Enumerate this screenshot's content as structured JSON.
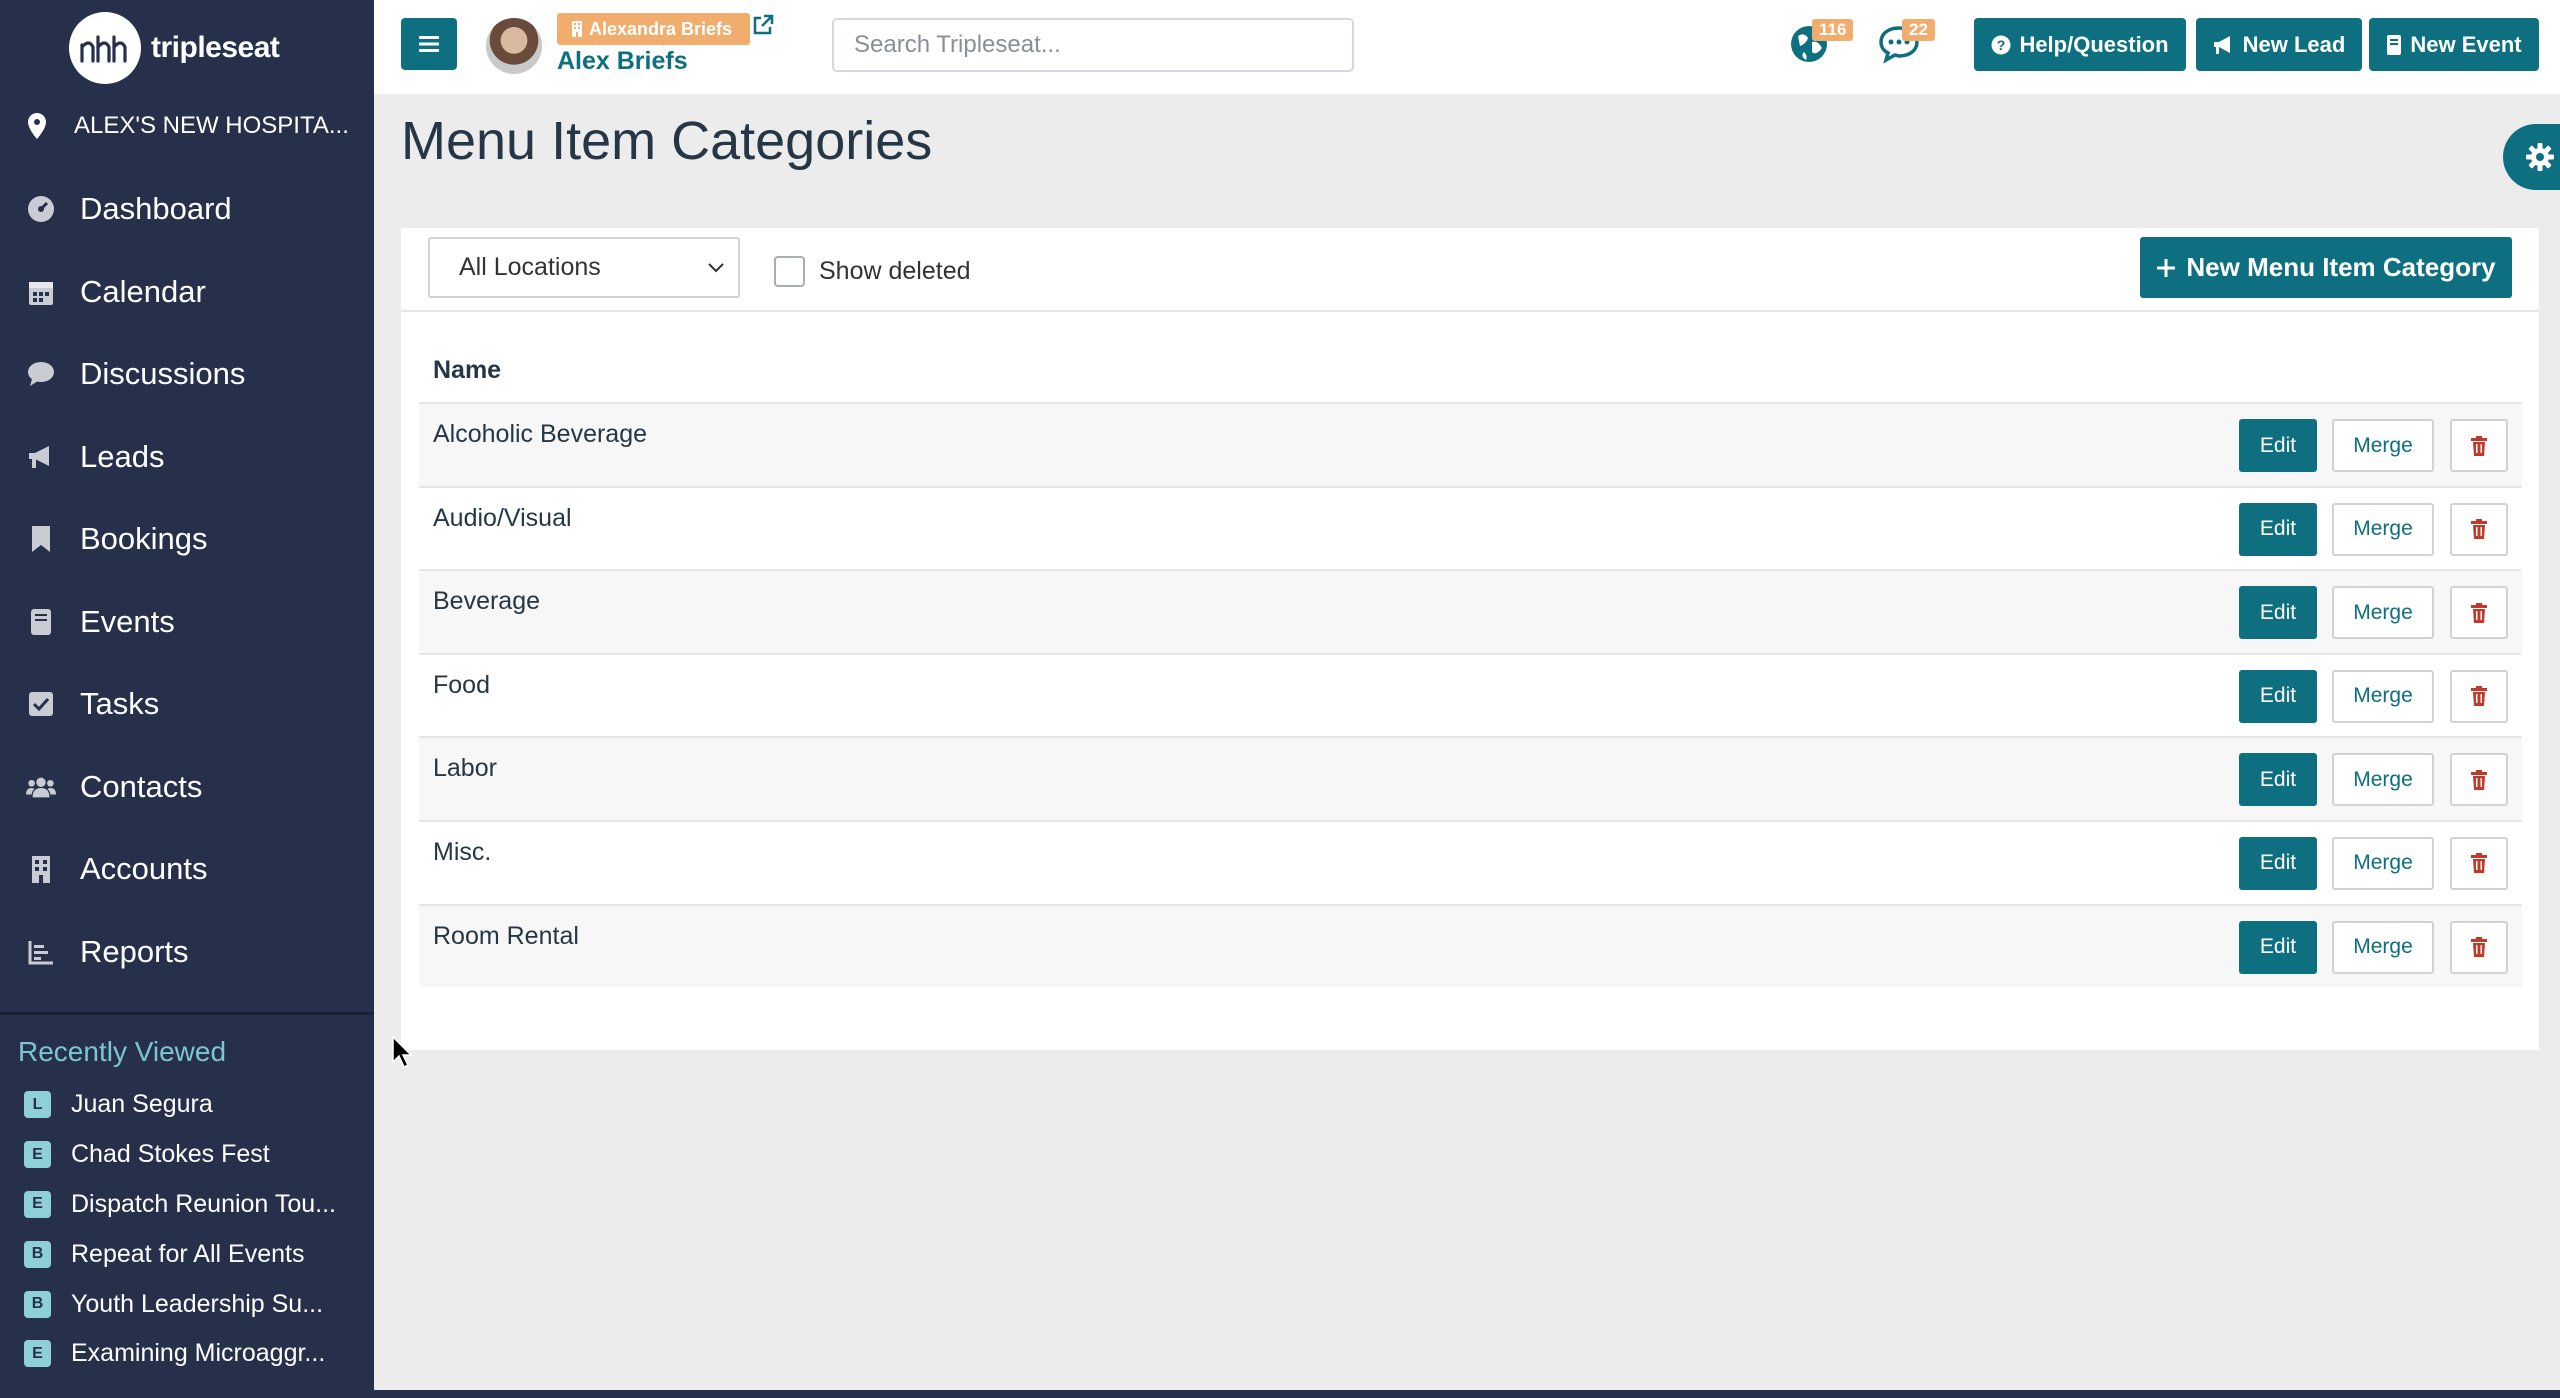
{
  "app": {
    "logo_text": "tripleseat",
    "location": "ALEX'S NEW HOSPITA...",
    "nav": [
      {
        "label": "Dashboard",
        "icon": "dashboard-icon"
      },
      {
        "label": "Calendar",
        "icon": "calendar-icon"
      },
      {
        "label": "Discussions",
        "icon": "chat-bubble-icon"
      },
      {
        "label": "Leads",
        "icon": "megaphone-icon"
      },
      {
        "label": "Bookings",
        "icon": "bookmark-icon"
      },
      {
        "label": "Events",
        "icon": "book-icon"
      },
      {
        "label": "Tasks",
        "icon": "checkbox-icon"
      },
      {
        "label": "Contacts",
        "icon": "users-icon"
      },
      {
        "label": "Accounts",
        "icon": "building-icon"
      },
      {
        "label": "Reports",
        "icon": "bar-chart-icon"
      }
    ],
    "recently_viewed": {
      "title": "Recently Viewed",
      "items": [
        {
          "badge": "L",
          "label": "Juan Segura"
        },
        {
          "badge": "E",
          "label": "Chad Stokes Fest"
        },
        {
          "badge": "E",
          "label": "Dispatch Reunion Tou..."
        },
        {
          "badge": "B",
          "label": "Repeat for All Events"
        },
        {
          "badge": "B",
          "label": "Youth Leadership Su..."
        },
        {
          "badge": "E",
          "label": "Examining Microaggr..."
        }
      ]
    }
  },
  "topbar": {
    "user_badge": "Alexandra Briefs",
    "user_name": "Alex Briefs",
    "search_placeholder": "Search Tripleseat...",
    "notifications": [
      {
        "icon": "globe-icon",
        "count": "116"
      },
      {
        "icon": "chat-icon",
        "count": "22"
      }
    ],
    "buttons": {
      "help": "Help/Question",
      "new_lead": "New Lead",
      "new_event": "New Event"
    }
  },
  "page": {
    "title": "Menu Item Categories",
    "filter": {
      "location": "All Locations",
      "show_deleted_label": "Show deleted",
      "show_deleted": false
    },
    "new_button": "New Menu Item Category",
    "column_header": "Name",
    "row_actions": {
      "edit": "Edit",
      "merge": "Merge"
    },
    "categories": [
      "Alcoholic Beverage",
      "Audio/Visual",
      "Beverage",
      "Food",
      "Labor",
      "Misc.",
      "Room Rental"
    ]
  },
  "colors": {
    "sidebar_bg": "#26304a",
    "accent": "#0d6f7f",
    "badge_orange": "#f0ad6e",
    "recently_viewed": "#7cc6cf",
    "delete_red": "#c0392b"
  }
}
